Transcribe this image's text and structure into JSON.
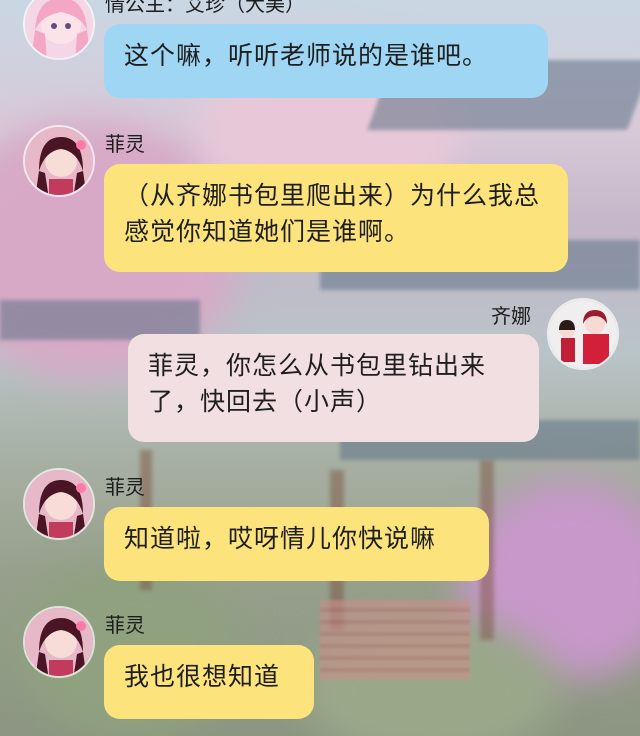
{
  "messages": [
    {
      "sender": "情公主：艾珍（大美）",
      "text": "这个嘛，听听老师说的是谁吧。"
    },
    {
      "sender": "菲灵",
      "text": "（从齐娜书包里爬出来）为什么我总感觉你知道她们是谁啊。"
    },
    {
      "sender": "齐娜",
      "text": "菲灵，你怎么从书包里钻出来了，快回去（小声）"
    },
    {
      "sender": "菲灵",
      "text": "知道啦，哎呀情儿你快说嘛"
    },
    {
      "sender": "菲灵",
      "text": "我也很想知道"
    }
  ],
  "colors": {
    "bubble_blue": "#9fd6f3",
    "bubble_yellow": "#fde37c",
    "bubble_pink": "#f2dfe2"
  }
}
